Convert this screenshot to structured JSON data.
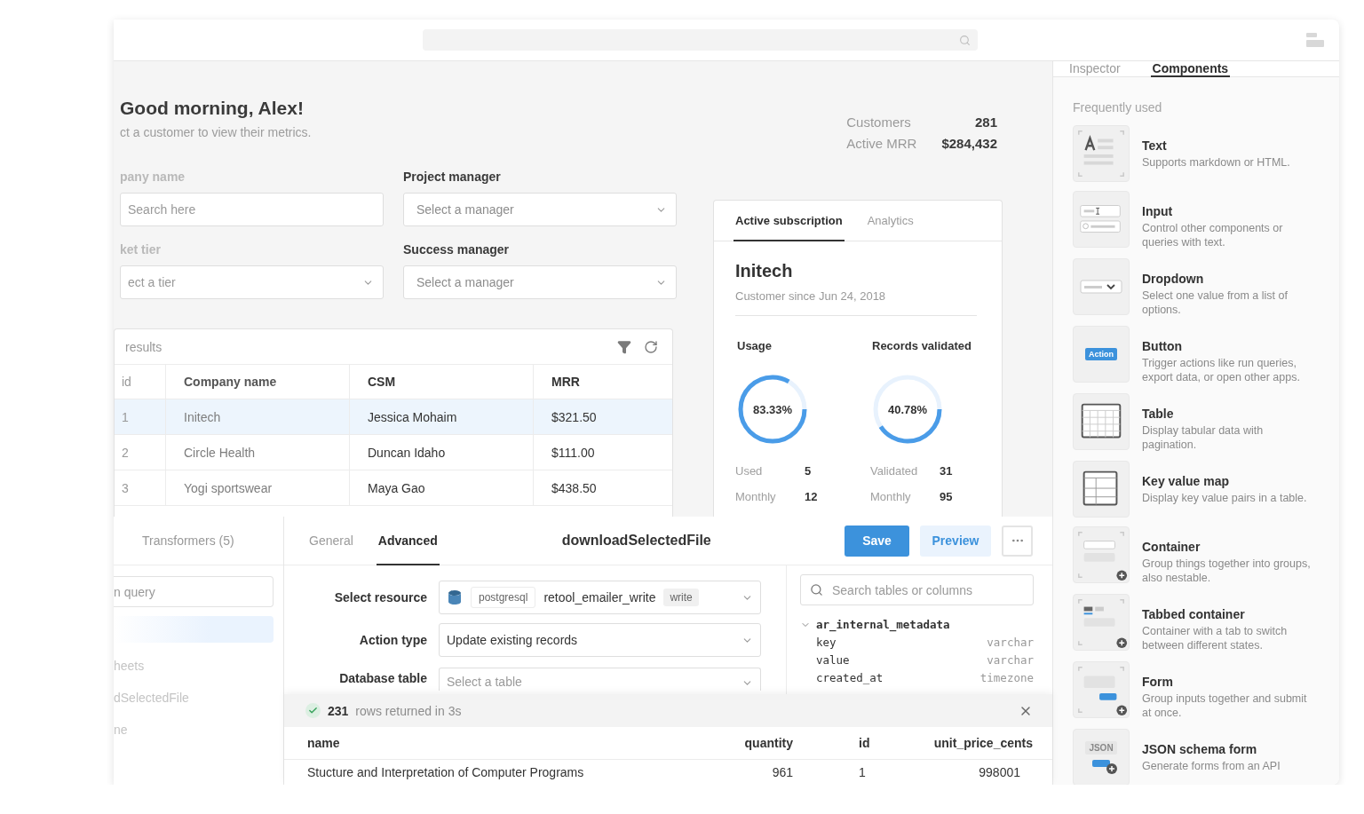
{
  "greeting": {
    "title": "Good morning, Alex!",
    "subtitle": "ct a customer to view their metrics."
  },
  "stats": [
    {
      "label": "Customers",
      "value": "281"
    },
    {
      "label": "Active MRR",
      "value": "$284,432"
    }
  ],
  "filters": [
    {
      "label": "pany name",
      "kind": "search",
      "placeholder": "Search here"
    },
    {
      "label": "Project manager",
      "kind": "select",
      "placeholder": "Select a manager"
    },
    {
      "label": "ket tier",
      "kind": "select",
      "placeholder": "ect a tier"
    },
    {
      "label": "Success manager",
      "kind": "select",
      "placeholder": "Select a manager"
    }
  ],
  "table": {
    "caption": "results",
    "columns": [
      "id",
      "Company name",
      "CSM",
      "MRR"
    ],
    "rows": [
      {
        "cells": [
          "1",
          "Initech",
          "Jessica Mohaim",
          "$321.50"
        ],
        "selected": true
      },
      {
        "cells": [
          "2",
          "Circle Health",
          "Duncan Idaho",
          "$111.00"
        ],
        "selected": false
      },
      {
        "cells": [
          "3",
          "Yogi sportswear",
          "Maya Gao",
          "$438.50"
        ],
        "selected": false
      }
    ]
  },
  "subscription": {
    "tabs": [
      {
        "label": "Active subscription",
        "selected": true
      },
      {
        "label": "Analytics",
        "selected": false
      }
    ],
    "name": "Initech",
    "since": "Customer since Jun 24, 2018",
    "metrics": [
      {
        "title": "Usage",
        "level": 0.8333,
        "reading": "83.33%",
        "rows": [
          {
            "label": "Used",
            "value": "5"
          },
          {
            "label": "Monthly",
            "value": "12"
          }
        ]
      },
      {
        "title": "Records validated",
        "level": 0.4078,
        "reading": "40.78%",
        "rows": [
          {
            "label": "Validated",
            "value": "31"
          },
          {
            "label": "Monthly",
            "value": "95"
          }
        ]
      }
    ]
  },
  "query_list": {
    "tab": "Transformers (5)",
    "search_placeholder": "n query",
    "items": [
      {
        "selected": true
      },
      {
        "label": "heets",
        "selected": false
      },
      {
        "label": "dSelectedFile",
        "selected": false
      },
      {
        "label": "ne",
        "selected": false
      }
    ]
  },
  "editor": {
    "tabs": [
      {
        "label": "General",
        "selected": false
      },
      {
        "label": "Advanced",
        "selected": true
      }
    ],
    "title": "downloadSelectedFile",
    "buttons": [
      {
        "label": "Save",
        "kind": "primary"
      },
      {
        "label": "Preview",
        "kind": "secondary"
      },
      {
        "kind": "more"
      }
    ],
    "fields": [
      {
        "label": "Select resource",
        "kind": "resource",
        "tag": "postgresql",
        "value": "retool_emailer_write",
        "badge": "write"
      },
      {
        "label": "Action type",
        "kind": "select",
        "value": "Update existing records"
      },
      {
        "label": "Database table",
        "kind": "select",
        "placeholder": "Select a table"
      }
    ],
    "schema": {
      "search_placeholder": "Search tables or columns",
      "tables": [
        {
          "name": "ar_internal_metadata",
          "expanded": true,
          "children": [
            {
              "name": "key",
              "type": "varchar"
            },
            {
              "name": "value",
              "type": "varchar"
            },
            {
              "name": "created_at",
              "type": "timezone"
            }
          ]
        }
      ]
    },
    "results": {
      "count": "231",
      "message": "rows returned in 3s",
      "columns": [
        "name",
        "quantity",
        "id",
        "unit_price_cents"
      ],
      "rows": [
        [
          "Stucture and Interpretation of Computer Programs",
          "961",
          "1",
          "998001"
        ]
      ]
    }
  },
  "inspector": {
    "tabs": [
      {
        "label": "Inspector",
        "selected": false
      },
      {
        "label": "Components",
        "selected": true
      }
    ],
    "section": "Frequently used",
    "components": [
      {
        "kind": "text",
        "title": "Text",
        "description": "Supports markdown or HTML."
      },
      {
        "kind": "input",
        "title": "Input",
        "description": "Control other components or queries with text."
      },
      {
        "kind": "dropdown",
        "title": "Dropdown",
        "description": "Select one value from a list of options."
      },
      {
        "kind": "button",
        "icon_label": "Action",
        "title": "Button",
        "description": "Trigger actions like run queries, export data, or open other apps."
      },
      {
        "kind": "table",
        "title": "Table",
        "description": "Display tabular data with pagination."
      },
      {
        "kind": "keyvalue",
        "title": "Key value map",
        "description": "Display key value pairs in a table."
      },
      {
        "kind": "container",
        "title": "Container",
        "description": "Group things together into groups, also nestable."
      },
      {
        "kind": "tabbed",
        "title": "Tabbed container",
        "description": "Container with a tab to switch between different states."
      },
      {
        "kind": "form",
        "title": "Form",
        "description": "Group inputs together and submit at once."
      },
      {
        "kind": "json",
        "icon_label": "JSON",
        "title": "JSON schema form",
        "description": "Generate forms from an API"
      }
    ]
  }
}
